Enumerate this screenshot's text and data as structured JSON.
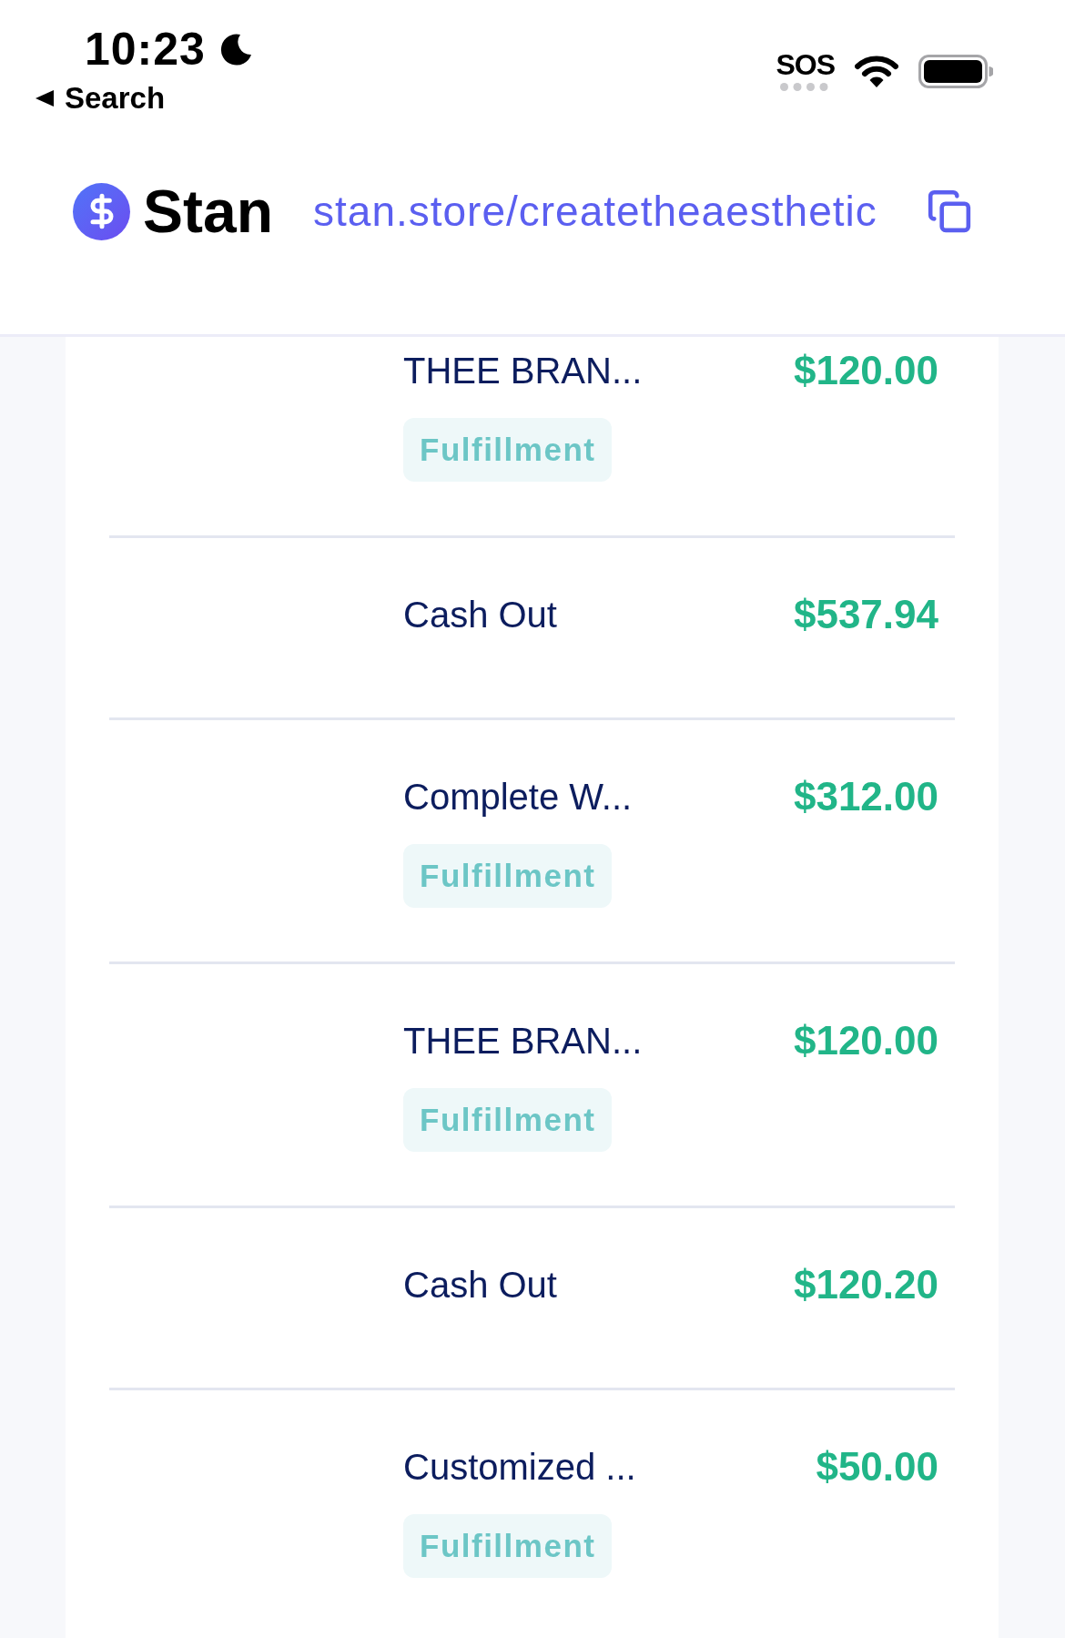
{
  "status_bar": {
    "time": "10:23",
    "back_label": "Search",
    "sos": "SOS"
  },
  "header": {
    "brand": "Stan",
    "url": "stan.store/createtheaesthetic"
  },
  "transactions": [
    {
      "title": "THEE BRAN...",
      "amount": "$120.00",
      "badge": "Fulfillment"
    },
    {
      "title": "Cash Out",
      "amount": "$537.94"
    },
    {
      "title": "Complete W...",
      "amount": "$312.00",
      "badge": "Fulfillment"
    },
    {
      "title": "THEE BRAN...",
      "amount": "$120.00",
      "badge": "Fulfillment"
    },
    {
      "title": "Cash Out",
      "amount": "$120.20"
    },
    {
      "title": "Customized ...",
      "amount": "$50.00",
      "badge": "Fulfillment"
    }
  ]
}
